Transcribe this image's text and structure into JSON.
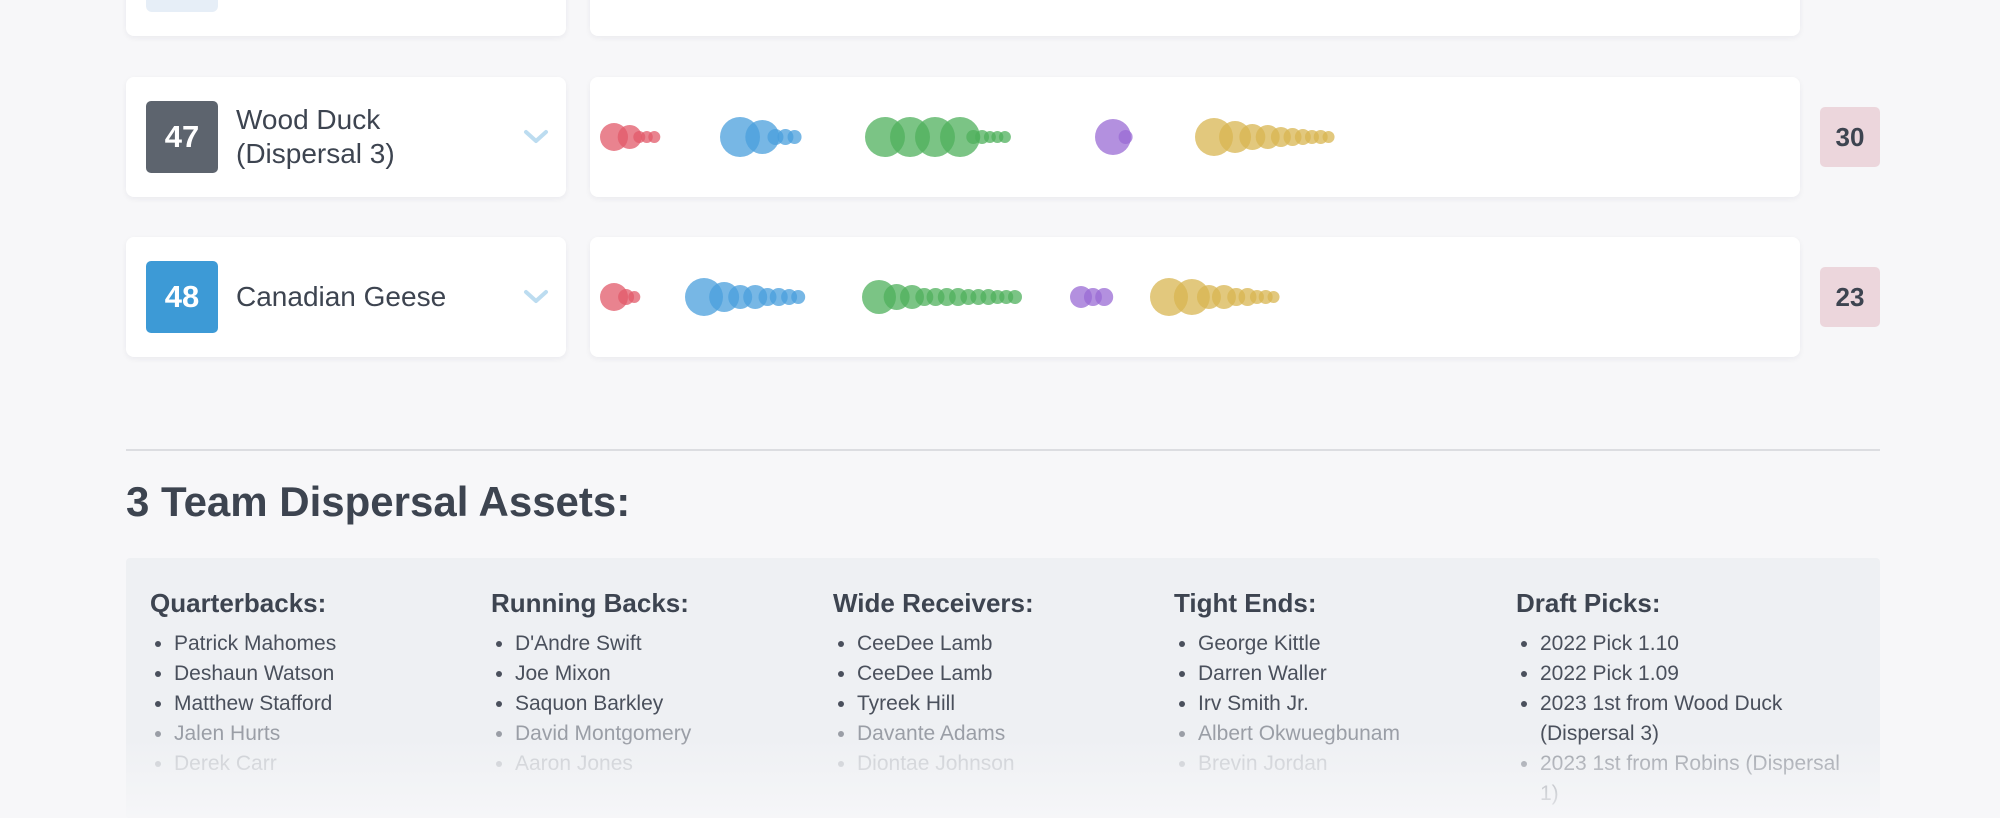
{
  "colors": {
    "qb": "#e15a6a",
    "rb": "#4a9fdc",
    "wr": "#4fb05c",
    "te": "#9a6bd4",
    "pick": "#d8b652",
    "rank_dark": "#5d646e",
    "rank_blue": "#3d9ad6",
    "score_bg": "#ecd6dc"
  },
  "teams": [
    {
      "rank": "47",
      "name": "Wood Duck (Dispersal 3)",
      "rank_color": "#5d646e",
      "score": "30",
      "groups": [
        {
          "position": "QB",
          "color": "#e15a6a",
          "sizes": [
            14,
            12,
            6,
            6,
            6
          ]
        },
        {
          "position": "RB",
          "color": "#4a9fdc",
          "sizes": [
            20,
            17,
            8,
            8,
            7
          ]
        },
        {
          "position": "WR",
          "color": "#4fb05c",
          "sizes": [
            20,
            20,
            20,
            20,
            7,
            7,
            6,
            6,
            6
          ]
        },
        {
          "position": "TE",
          "color": "#9a6bd4",
          "sizes": [
            18,
            7
          ]
        },
        {
          "position": "PICK",
          "color": "#d8b652",
          "sizes": [
            19,
            16,
            13,
            12,
            10,
            9,
            8,
            7,
            7,
            6
          ]
        }
      ]
    },
    {
      "rank": "48",
      "name": "Canadian Geese",
      "rank_color": "#3d9ad6",
      "score": "23",
      "groups": [
        {
          "position": "QB",
          "color": "#e15a6a",
          "sizes": [
            14,
            8,
            6
          ]
        },
        {
          "position": "RB",
          "color": "#4a9fdc",
          "sizes": [
            19,
            15,
            12,
            12,
            9,
            9,
            8,
            7
          ]
        },
        {
          "position": "WR",
          "color": "#4fb05c",
          "sizes": [
            17,
            13,
            12,
            9,
            9,
            9,
            9,
            8,
            8,
            8,
            7,
            7,
            7
          ]
        },
        {
          "position": "TE",
          "color": "#9a6bd4",
          "sizes": [
            11,
            9,
            9
          ]
        },
        {
          "position": "PICK",
          "color": "#d8b652",
          "sizes": [
            19,
            18,
            12,
            12,
            9,
            9,
            7,
            7,
            6
          ]
        }
      ]
    }
  ],
  "dispersal": {
    "title": "3 Team Dispersal Assets:",
    "columns": [
      {
        "heading": "Quarterbacks:",
        "items": [
          "Patrick Mahomes",
          "Deshaun Watson",
          "Matthew Stafford",
          "Jalen Hurts",
          "Derek Carr"
        ]
      },
      {
        "heading": "Running Backs:",
        "items": [
          "D'Andre Swift",
          "Joe Mixon",
          "Saquon Barkley",
          "David Montgomery",
          "Aaron Jones"
        ]
      },
      {
        "heading": "Wide Receivers:",
        "items": [
          "CeeDee Lamb",
          "CeeDee Lamb",
          "Tyreek Hill",
          "Davante Adams",
          "Diontae Johnson"
        ]
      },
      {
        "heading": "Tight Ends:",
        "items": [
          "George Kittle",
          "Darren Waller",
          "Irv Smith Jr.",
          "Albert Okwuegbunam",
          "Brevin Jordan"
        ]
      },
      {
        "heading": "Draft Picks:",
        "items": [
          "2022 Pick 1.10",
          "2022 Pick 1.09",
          "2023 1st from Wood Duck (Dispersal 3)",
          "2023 1st from Robins (Dispersal 1)"
        ]
      }
    ]
  }
}
